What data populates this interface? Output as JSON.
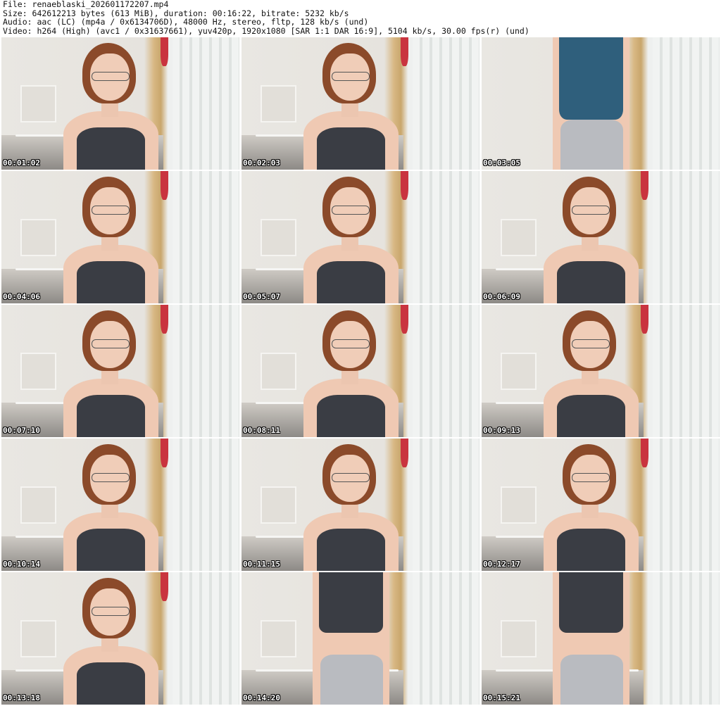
{
  "header": {
    "file_line": "File: renaeblaski_202601172207.mp4",
    "size_line": "Size: 642612213 bytes (613 MiB), duration: 00:16:22, bitrate: 5232 kb/s",
    "audio_line": "Audio: aac (LC) (mp4a / 0x6134706D), 48000 Hz, stereo, fltp, 128 kb/s (und)",
    "video_line": "Video: h264 (High) (avc1 / 0x31637661), yuv420p, 1920x1080 [SAR 1:1 DAR 16:9], 5104 kb/s, 30.00 fps(r) (und)"
  },
  "thumbnails": [
    {
      "time": "00:01:02"
    },
    {
      "time": "00:02:03"
    },
    {
      "time": "00:03:05"
    },
    {
      "time": "00:04:06"
    },
    {
      "time": "00:05:07"
    },
    {
      "time": "00:06:09"
    },
    {
      "time": "00:07:10"
    },
    {
      "time": "00:08:11"
    },
    {
      "time": "00:09:13"
    },
    {
      "time": "00:10:14"
    },
    {
      "time": "00:11:15"
    },
    {
      "time": "00:12:17"
    },
    {
      "time": "00:13:18"
    },
    {
      "time": "00:14:20"
    },
    {
      "time": "00:15:21"
    }
  ]
}
